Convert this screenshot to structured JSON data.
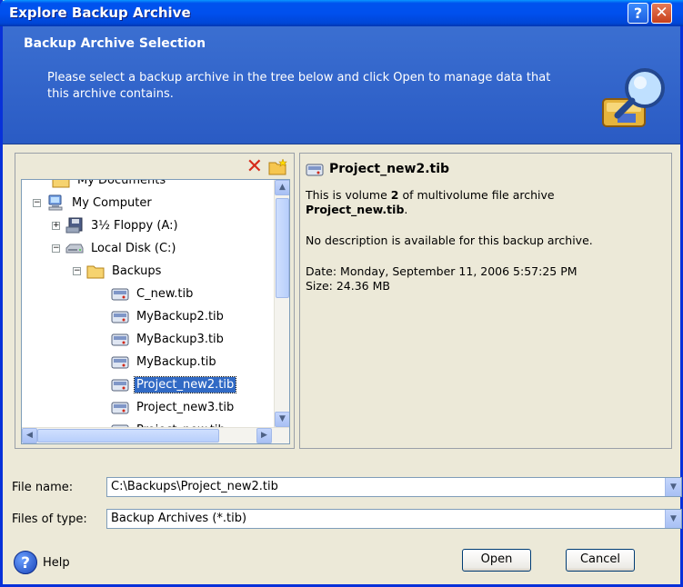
{
  "window": {
    "title": "Explore Backup Archive",
    "help_button": "?",
    "close_button": "✕"
  },
  "header": {
    "title": "Backup Archive Selection",
    "description": "Please select a backup archive in the tree below and click Open to manage data that this archive contains."
  },
  "tree": {
    "items": [
      {
        "label": "My Documents",
        "level": 1,
        "expander": "",
        "icon": "folder-icon"
      },
      {
        "label": "My Computer",
        "level": 0,
        "expander": "−",
        "icon": "computer-icon"
      },
      {
        "label": "3½ Floppy (A:)",
        "level": 1,
        "expander": "+",
        "icon": "floppy-icon"
      },
      {
        "label": "Local Disk (C:)",
        "level": 1,
        "expander": "−",
        "icon": "disk-icon"
      },
      {
        "label": "Backups",
        "level": 2,
        "expander": "−",
        "icon": "folder-icon"
      },
      {
        "label": "C_new.tib",
        "level": 3,
        "expander": "",
        "icon": "archive-icon"
      },
      {
        "label": "MyBackup2.tib",
        "level": 3,
        "expander": "",
        "icon": "archive-icon"
      },
      {
        "label": "MyBackup3.tib",
        "level": 3,
        "expander": "",
        "icon": "archive-icon"
      },
      {
        "label": "MyBackup.tib",
        "level": 3,
        "expander": "",
        "icon": "archive-icon"
      },
      {
        "label": "Project_new2.tib",
        "level": 3,
        "expander": "",
        "icon": "archive-icon",
        "selected": true
      },
      {
        "label": "Project_new3.tib",
        "level": 3,
        "expander": "",
        "icon": "archive-icon"
      },
      {
        "label": "Project_new.tib",
        "level": 3,
        "expander": "",
        "icon": "archive-icon"
      }
    ]
  },
  "details": {
    "filename": "Project_new2.tib",
    "volume_prefix": "This is volume ",
    "volume_number": "2",
    "volume_suffix": " of multivolume file archive",
    "archive_name": "Project_new.tib",
    "archive_suffix": ".",
    "description": "No description is available for this backup archive.",
    "date": "Date: Monday, September 11, 2006 5:57:25 PM",
    "size": "Size: 24.36 MB"
  },
  "fields": {
    "file_name_label": "File name:",
    "file_name_value": "C:\\Backups\\Project_new2.tib",
    "file_type_label": "Files of type:",
    "file_type_value": "Backup Archives (*.tib)"
  },
  "footer": {
    "help_label": "Help",
    "open_label": "Open",
    "cancel_label": "Cancel"
  }
}
